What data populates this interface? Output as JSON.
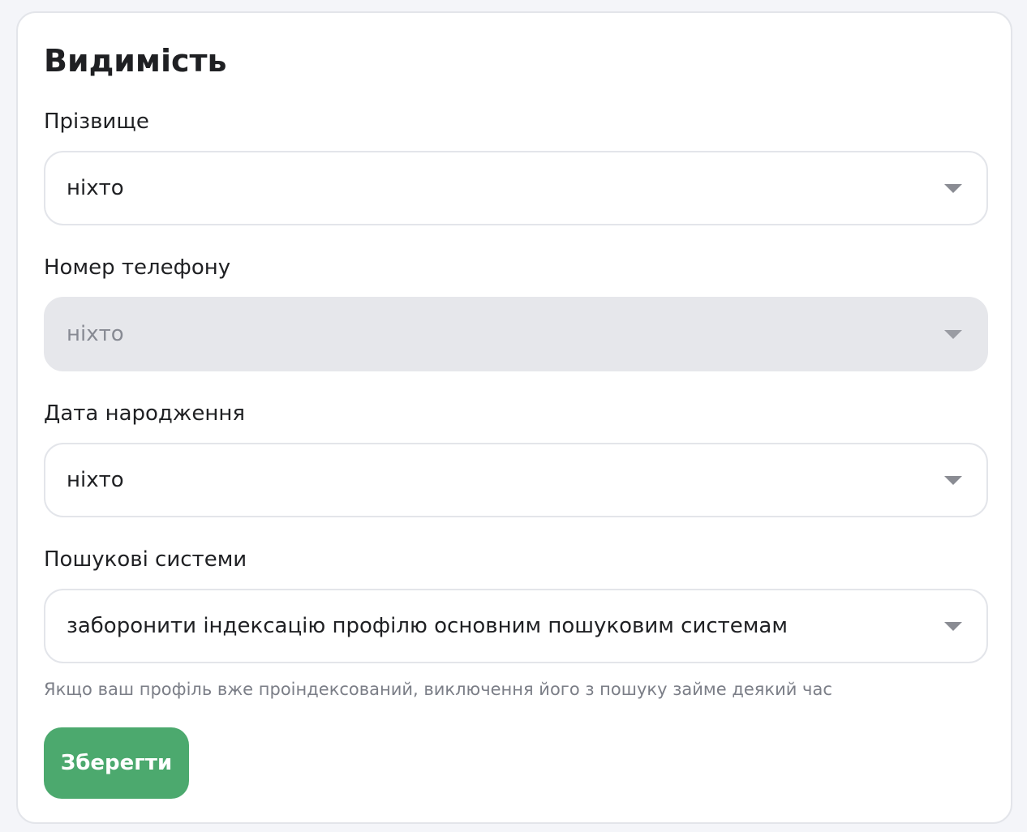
{
  "card": {
    "title": "Видимість"
  },
  "fields": [
    {
      "label": "Прізвище",
      "value": "ніхто",
      "disabled": false
    },
    {
      "label": "Номер телефону",
      "value": "ніхто",
      "disabled": true
    },
    {
      "label": "Дата народження",
      "value": "ніхто",
      "disabled": false
    },
    {
      "label": "Пошукові системи",
      "value": "заборонити індексацію профілю основним пошуковим системам",
      "disabled": false
    }
  ],
  "hint": "Якщо ваш профіль вже проіндексований, виключення його з пошуку займе деякий час",
  "actions": {
    "save_label": "Зберегти",
    "save_color": "#4ca96e"
  },
  "icons": {
    "dropdown": "chevron-down-icon"
  }
}
